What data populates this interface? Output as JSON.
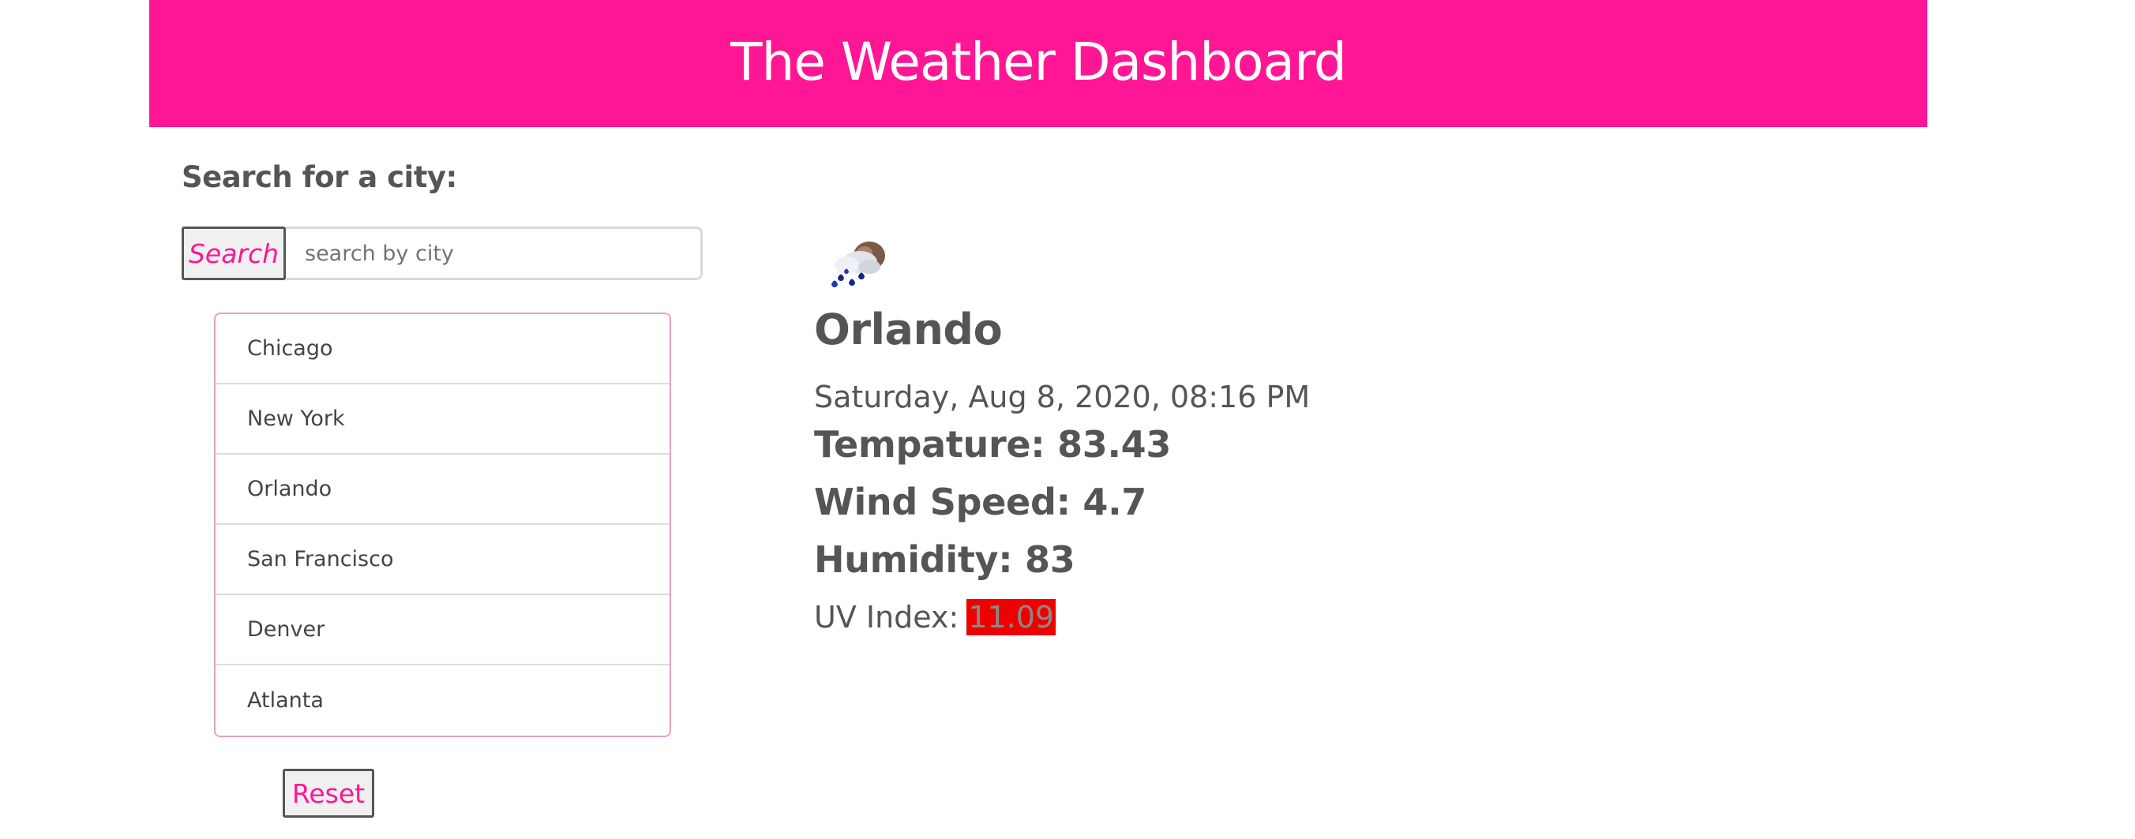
{
  "header": {
    "title": "The Weather Dashboard"
  },
  "search": {
    "label": "Search for a city:",
    "button_label": "Search",
    "placeholder": "search by city",
    "value": ""
  },
  "cities": [
    {
      "name": "Chicago"
    },
    {
      "name": "New York"
    },
    {
      "name": "Orlando"
    },
    {
      "name": "San Francisco"
    },
    {
      "name": "Denver"
    },
    {
      "name": "Atlanta"
    }
  ],
  "reset": {
    "label": "Reset"
  },
  "weather": {
    "icon": "rain-and-cloud-icon",
    "city": "Orlando",
    "date": "Saturday, Aug 8, 2020, 08:16 PM",
    "temperature": "Tempature: 83.43",
    "wind_speed": "Wind Speed: 4.7",
    "humidity": "Humidity: 83",
    "uv_label": "UV Index:",
    "uv_value": "11.09",
    "uv_color": "#ee0000"
  },
  "colors": {
    "accent": "#ff1694",
    "text": "#555555",
    "list_border": "#e9a0bf"
  }
}
